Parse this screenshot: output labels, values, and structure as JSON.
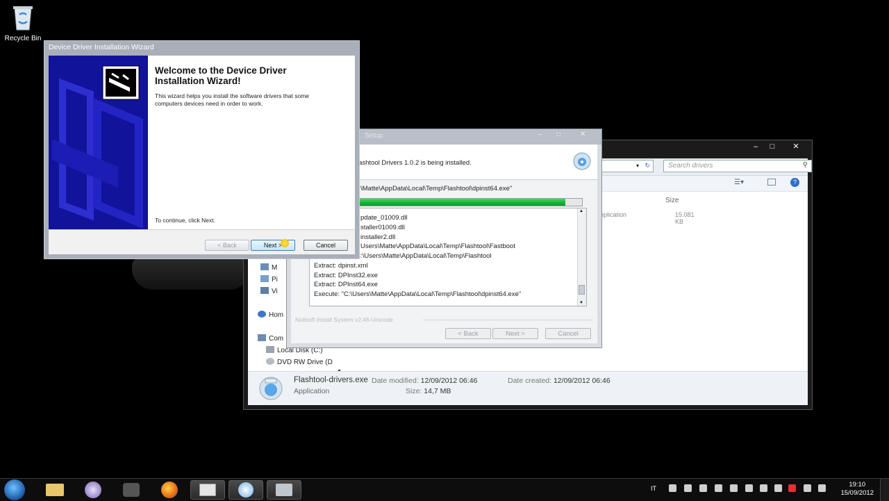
{
  "desktop": {
    "recycle_bin_label": "Recycle Bin"
  },
  "explorer": {
    "search_placeholder": "Search drivers",
    "column_size": "Size",
    "file_type_fragment": "pplication",
    "file_size": "15.081 KB",
    "nav_items": [
      "M",
      "Pi",
      "Vi",
      "Hom",
      "Com",
      "Local Disk (C:)",
      "DVD RW Drive (D"
    ],
    "details": {
      "file_name": "Flashtool-drivers.exe",
      "file_type": "Application",
      "date_modified_label": "Date modified:",
      "date_modified": "12/09/2012 06:46",
      "size_label": "Size:",
      "size": "14,7 MB",
      "date_created_label": "Date created:",
      "date_created": "12/09/2012 06:46"
    }
  },
  "setup": {
    "title": "Setup",
    "status": "lashtool Drivers 1.0.2 is being installed.",
    "current_action": "\\Matte\\AppData\\Local\\Temp\\Flashtool\\dpinst64.exe\"",
    "progress_fraction": 0.94,
    "log_lines": [
      "pdate_01009.dll",
      "staller01009.dll",
      "installer2.dll",
      "Users\\Matte\\AppData\\Local\\Temp\\Flashtool\\Fastboot",
      "Output folder: C:\\Users\\Matte\\AppData\\Local\\Temp\\Flashtool",
      "Extract: dpinst.xml",
      "Extract: DPInst32.exe",
      "Extract: DPInst64.exe",
      "Execute: \"C:\\Users\\Matte\\AppData\\Local\\Temp\\Flashtool\\dpinst64.exe\""
    ],
    "branding": "Nullsoft Install System v2.46-Unicode",
    "back_label": "< Back",
    "next_label": "Next >",
    "cancel_label": "Cancel"
  },
  "wizard": {
    "title": "Device Driver Installation Wizard",
    "heading": "Welcome to the Device Driver Installation Wizard!",
    "description": "This wizard helps you install the software drivers that some computers devices need in order to work.",
    "continue_text": "To continue, click Next.",
    "back_label": "< Back",
    "next_label": "Next >",
    "cancel_label": "Cancel"
  },
  "taskbar": {
    "language": "IT",
    "time": "19:10",
    "date": "15/09/2012"
  }
}
